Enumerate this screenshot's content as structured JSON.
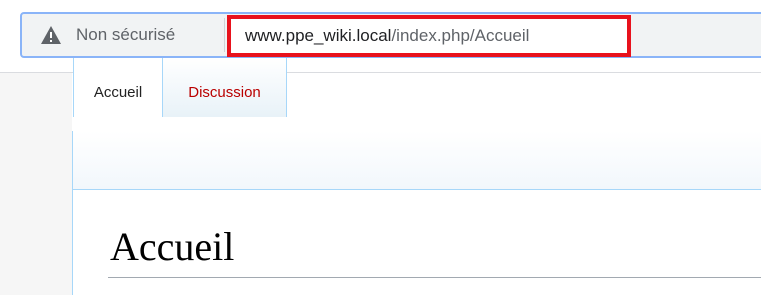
{
  "browser": {
    "security_label": "Non sécurisé",
    "url_host": "www.ppe_wiki.local",
    "url_path": "/index.php/Accueil",
    "highlight_color": "#e8121d",
    "warning_icon": "warning-triangle-icon"
  },
  "wiki": {
    "tabs": [
      {
        "label": "Accueil",
        "active": true
      },
      {
        "label": "Discussion",
        "active": false,
        "color": "#ba0000"
      }
    ],
    "page_title": "Accueil"
  }
}
